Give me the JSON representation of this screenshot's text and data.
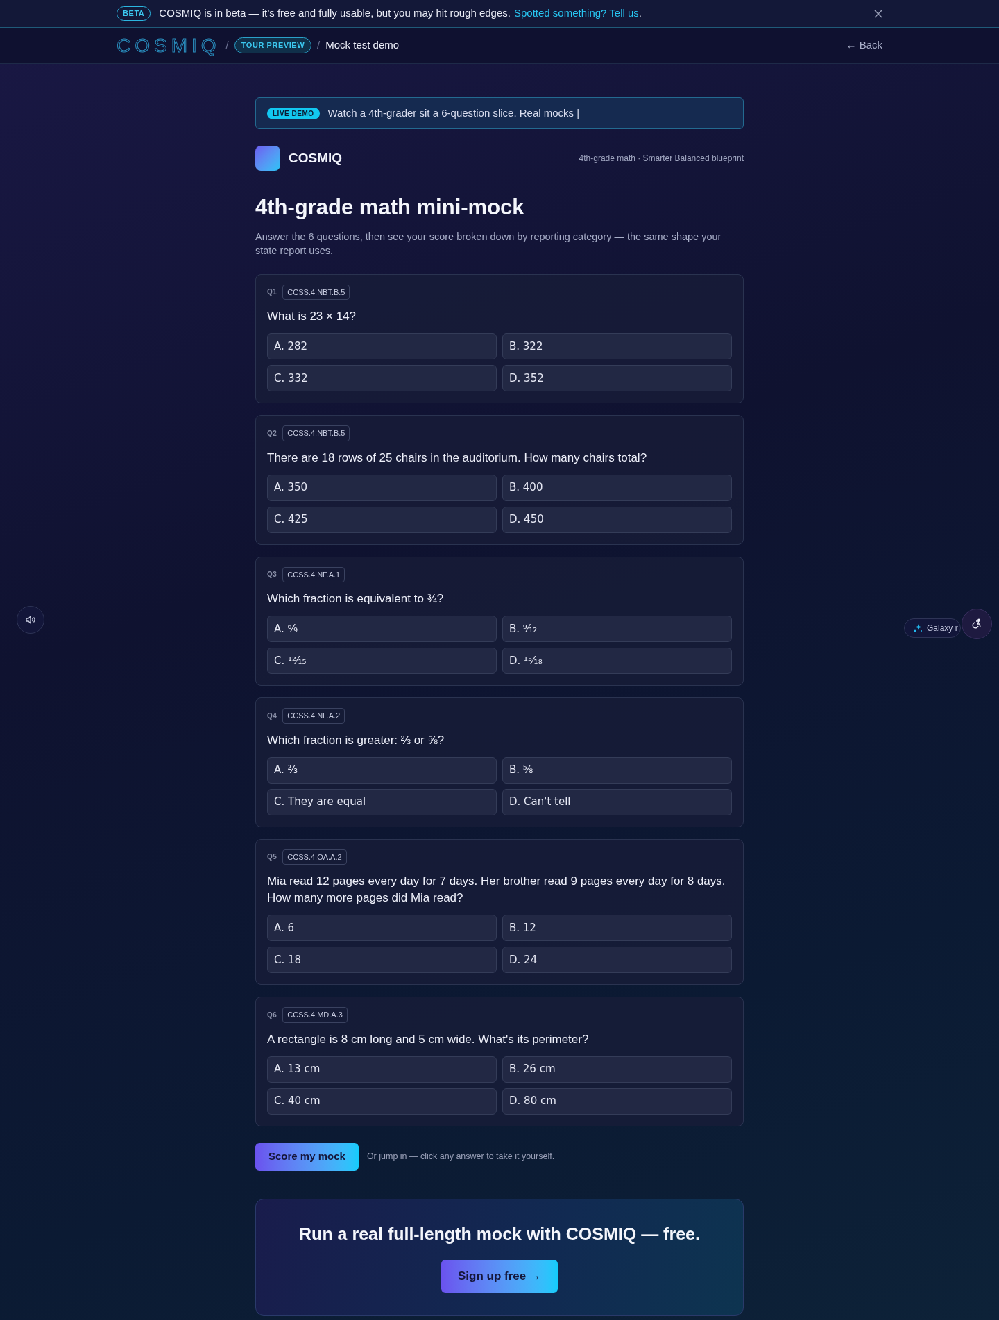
{
  "beta_bar": {
    "badge": "BETA",
    "message": "COSMIQ is in beta — it’s free and fully usable, but you may hit rough edges.",
    "link": "Spotted something? Tell us",
    "after_link": "."
  },
  "nav": {
    "logo": "COSMIQ",
    "separator": "/",
    "breadcrumb": [
      {
        "kind": "pill",
        "label": "TOUR PREVIEW"
      },
      {
        "kind": "text",
        "label": "Mock test demo"
      }
    ],
    "back": "← Back"
  },
  "live_demo": {
    "badge": "LIVE DEMO",
    "text": "Watch a 4th-grader sit a 6-question slice. Real mocks |"
  },
  "brand": {
    "name": "COSMIQ",
    "subtitle": "4th-grade math · Smarter Balanced blueprint"
  },
  "title": "4th-grade math mini-mock",
  "intro": "Answer the 6 questions, then see your score broken down by reporting category — the same shape your state report uses.",
  "questions": [
    {
      "number": "Q1",
      "standard": "CCSS.4.NBT.B.5",
      "text": "What is 23 × 14?",
      "options": [
        "A. 282",
        "B. 322",
        "C. 332",
        "D. 352"
      ]
    },
    {
      "number": "Q2",
      "standard": "CCSS.4.NBT.B.5",
      "text": "There are 18 rows of 25 chairs in the auditorium. How many chairs total?",
      "options": [
        "A. 350",
        "B. 400",
        "C. 425",
        "D. 450"
      ]
    },
    {
      "number": "Q3",
      "standard": "CCSS.4.NF.A.1",
      "text": "Which fraction is equivalent to ¾?",
      "options": [
        "A. ⁶⁄₉",
        "B. ⁹⁄₁₂",
        "C. ¹²⁄₁₅",
        "D. ¹⁵⁄₁₈"
      ]
    },
    {
      "number": "Q4",
      "standard": "CCSS.4.NF.A.2",
      "text": "Which fraction is greater: ⅔ or ⅝?",
      "options": [
        "A. ⅔",
        "B. ⅝",
        "C. They are equal",
        "D. Can't tell"
      ]
    },
    {
      "number": "Q5",
      "standard": "CCSS.4.OA.A.2",
      "text": "Mia read 12 pages every day for 7 days. Her brother read 9 pages every day for 8 days. How many more pages did Mia read?",
      "options": [
        "A. 6",
        "B. 12",
        "C. 18",
        "D. 24"
      ]
    },
    {
      "number": "Q6",
      "standard": "CCSS.4.MD.A.3",
      "text": "A rectangle is 8 cm long and 5 cm wide. What's its perimeter?",
      "options": [
        "A. 13 cm",
        "B. 26 cm",
        "C. 40 cm",
        "D. 80 cm"
      ]
    }
  ],
  "score_button": "Score my mock",
  "score_hint": "Or jump in — click any answer to take it yourself.",
  "cta": {
    "title": "Run a real full-length mock with COSMIQ — free.",
    "button": "Sign up free →"
  },
  "galaxy_pill": "Galaxy r"
}
